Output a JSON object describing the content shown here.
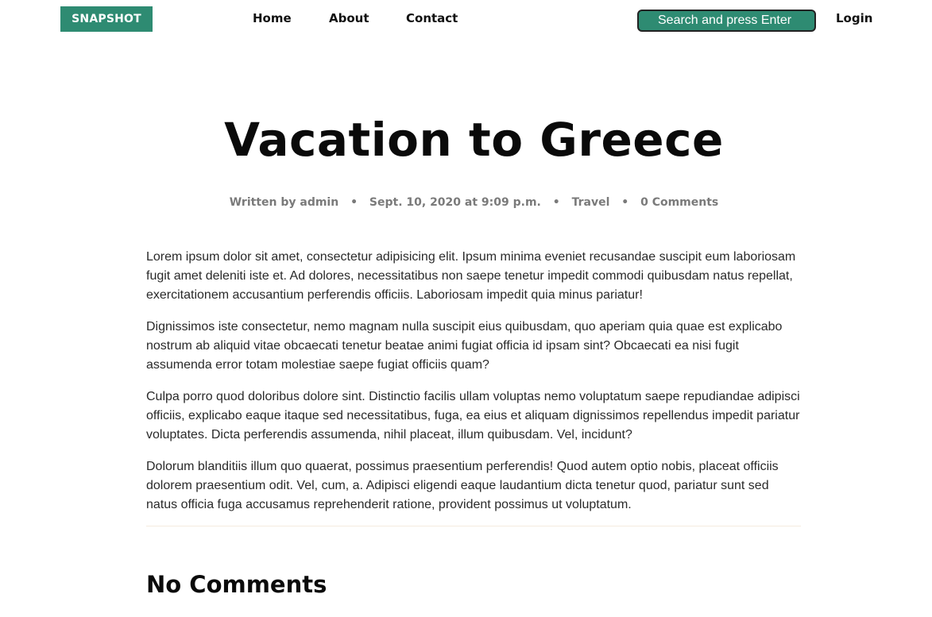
{
  "nav": {
    "brand": "SNAPSHOT",
    "links": [
      "Home",
      "About",
      "Contact"
    ],
    "search_placeholder": "Search and press Enter",
    "login": "Login"
  },
  "post": {
    "title": "Vacation to Greece",
    "author_text": "Written by admin",
    "date": "Sept. 10, 2020 at 9:09 p.m.",
    "category": "Travel",
    "comment_count": "0 Comments",
    "separator": "•",
    "paragraphs": [
      "Lorem ipsum dolor sit amet, consectetur adipisicing elit. Ipsum minima eveniet recusandae suscipit eum laboriosam fugit amet deleniti iste et. Ad dolores, necessitatibus non saepe tenetur impedit commodi quibusdam natus repellat, exercitationem accusantium perferendis officiis. Laboriosam impedit quia minus pariatur!",
      "Dignissimos iste consectetur, nemo magnam nulla suscipit eius quibusdam, quo aperiam quia quae est explicabo nostrum ab aliquid vitae obcaecati tenetur beatae animi fugiat officia id ipsam sint? Obcaecati ea nisi fugit assumenda error totam molestiae saepe fugiat officiis quam?",
      "Culpa porro quod doloribus dolore sint. Distinctio facilis ullam voluptas nemo voluptatum saepe repudiandae adipisci officiis, explicabo eaque itaque sed necessitatibus, fuga, ea eius et aliquam dignissimos repellendus impedit pariatur voluptates. Dicta perferendis assumenda, nihil placeat, illum quibusdam. Vel, incidunt?",
      "Dolorum blanditiis illum quo quaerat, possimus praesentium perferendis! Quod autem optio nobis, placeat officiis dolorem praesentium odit. Vel, cum, a. Adipisci eligendi eaque laudantium dicta tenetur quod, pariatur sunt sed natus officia fuga accusamus reprehenderit ratione, provident possimus ut voluptatum."
    ]
  },
  "comments": {
    "heading": "No Comments"
  },
  "colors": {
    "accent": "#2e8b72",
    "meta_text": "#7a7a7a"
  }
}
